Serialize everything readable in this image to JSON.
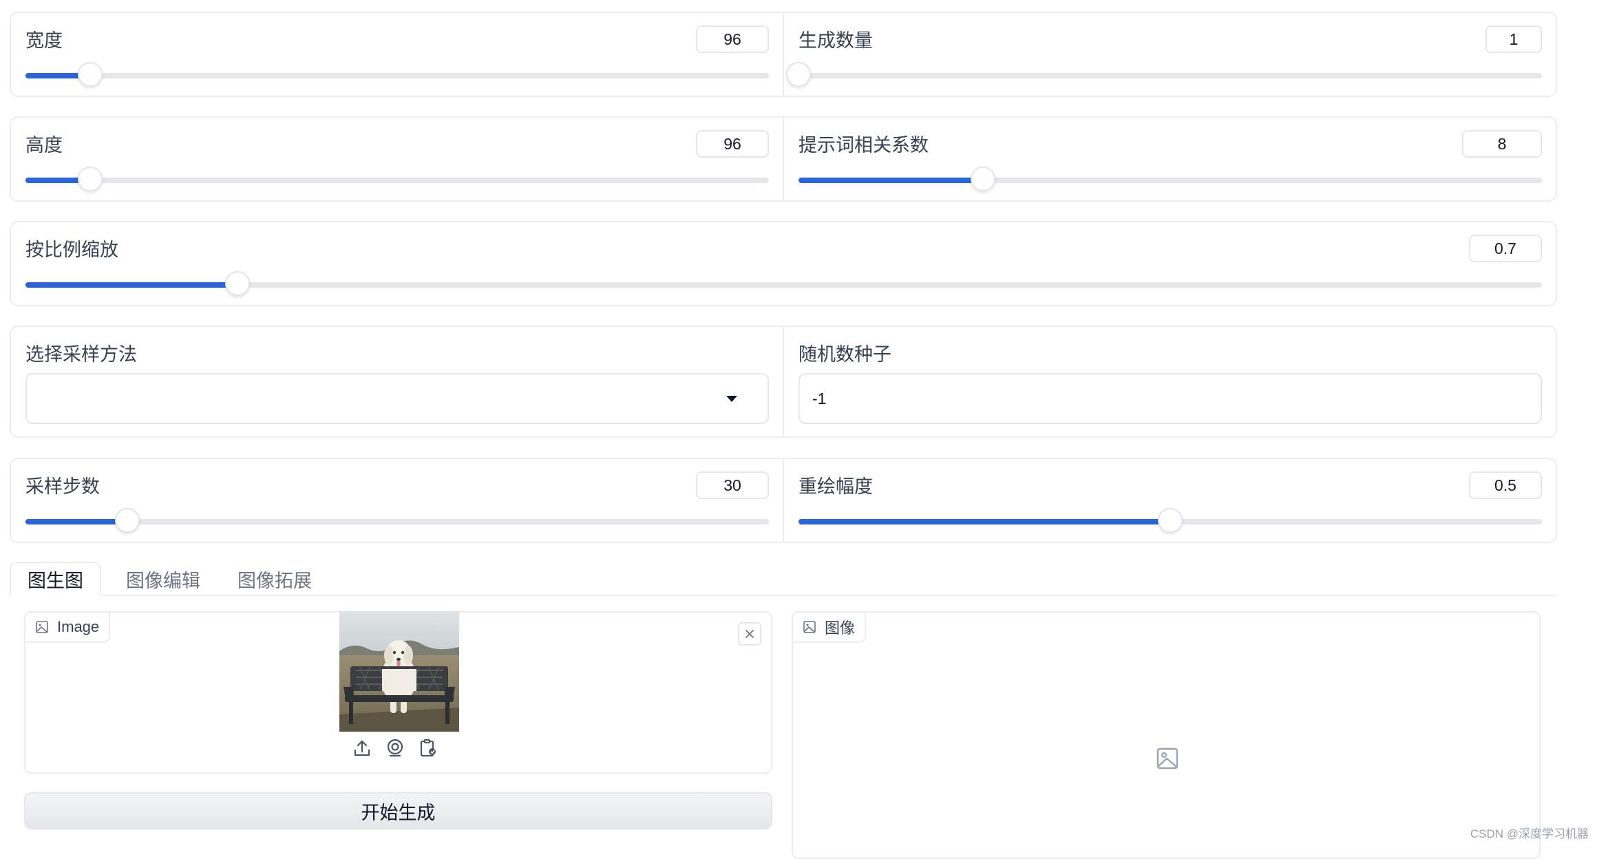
{
  "sliders": {
    "width": {
      "label": "宽度",
      "value": "96",
      "fraction": 0.087
    },
    "count": {
      "label": "生成数量",
      "value": "1",
      "fraction": 0.0
    },
    "height": {
      "label": "高度",
      "value": "96",
      "fraction": 0.087
    },
    "cfg": {
      "label": "提示词相关系数",
      "value": "8",
      "fraction": 0.248
    },
    "scale": {
      "label": "按比例缩放",
      "value": "0.7",
      "fraction": 0.14
    },
    "steps": {
      "label": "采样步数",
      "value": "30",
      "fraction": 0.137
    },
    "denoise": {
      "label": "重绘幅度",
      "value": "0.5",
      "fraction": 0.5
    }
  },
  "sampler": {
    "label": "选择采样方法",
    "value": ""
  },
  "seed": {
    "label": "随机数种子",
    "value": "-1"
  },
  "tabs": [
    "图生图",
    "图像编辑",
    "图像拓展"
  ],
  "input_image": {
    "chip_label": "Image",
    "actions": [
      "upload-icon",
      "webcam-icon",
      "clipboard-icon"
    ]
  },
  "output_image": {
    "chip_label": "图像"
  },
  "generate_button": "开始生成",
  "watermark": "CSDN @深度学习机器"
}
